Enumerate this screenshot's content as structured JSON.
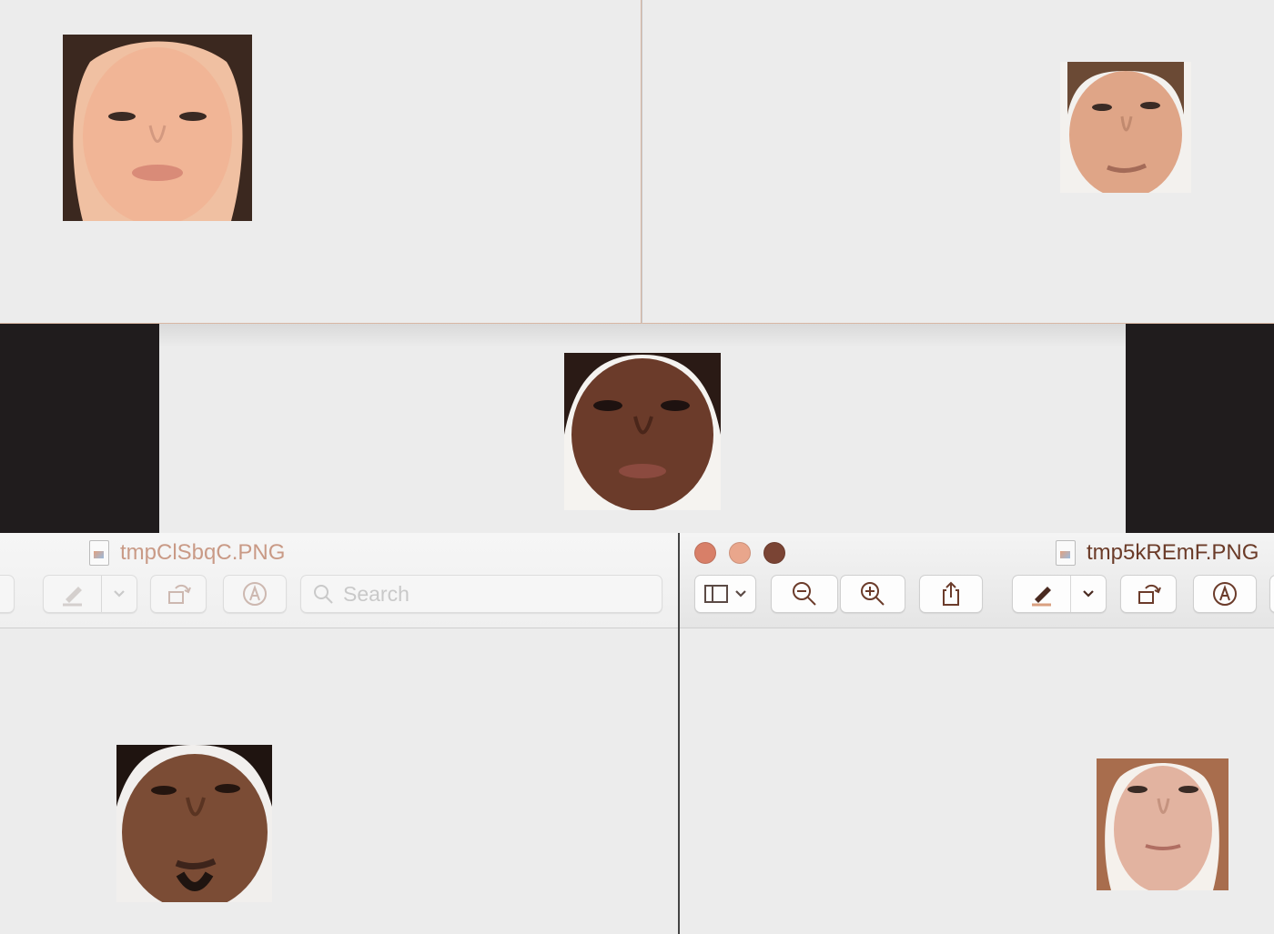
{
  "windows": {
    "bottom_left": {
      "title": "tmpClSbqC.PNG",
      "search_placeholder": "Search"
    },
    "bottom_right": {
      "title": "tmp5kREmF.PNG"
    }
  },
  "icons": {
    "markup": "pen-icon",
    "dropdown": "chevron-down-icon",
    "rotate": "rotate-icon",
    "annotate": "markup-circle-icon",
    "search": "search-icon",
    "sidebar": "sidebar-icon",
    "zoom_out": "zoom-out-icon",
    "zoom_in": "zoom-in-icon",
    "share": "share-icon"
  },
  "colors": {
    "close": "#d87f68",
    "minimize": "#e9a68c",
    "zoom": "#7a4434",
    "title_text": "#6b3b28",
    "inactive_title_text": "#c99a86"
  }
}
